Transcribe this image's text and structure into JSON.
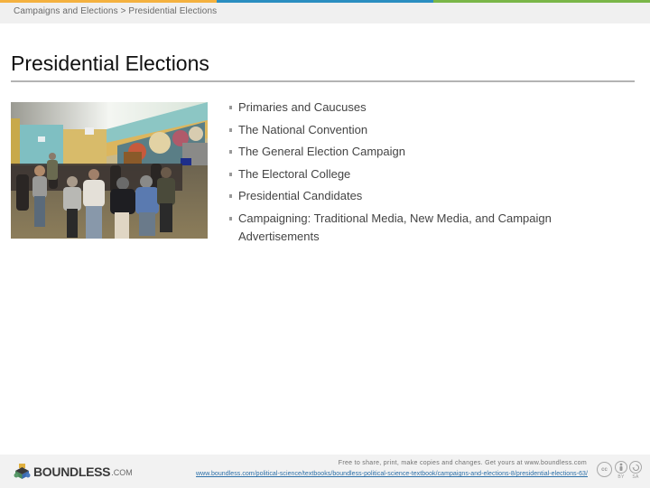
{
  "colors": {
    "bar_orange": "#f4b13f",
    "bar_blue": "#2b8ec1",
    "bar_green": "#7ab648",
    "link": "#2b6fa8"
  },
  "breadcrumb": {
    "items": [
      "Campaigns and Elections",
      "Presidential Elections"
    ],
    "separator": ">"
  },
  "title": "Presidential Elections",
  "photo": {
    "icon": "photo-crowd-rally",
    "description": "Crowd gathered in a school gymnasium with a mural for a caucus"
  },
  "bullets": [
    "Primaries and Caucuses",
    "The National Convention",
    "The General Election Campaign",
    "The Electoral College",
    "Presidential Candidates",
    "Campaigning: Traditional Media, New Media, and Campaign Advertisements"
  ],
  "footer": {
    "logo_text": "BOUNDLESS",
    "logo_suffix": ".COM",
    "share_text": "Free to share, print, make copies and changes. Get yours at www.boundless.com",
    "source_link": "www.boundless.com/political-science/textbooks/boundless-political-science-textbook/campaigns-and-elections-8/presidential-elections-63/",
    "license": {
      "cc": "cc",
      "by": "BY",
      "sa": "SA"
    }
  }
}
